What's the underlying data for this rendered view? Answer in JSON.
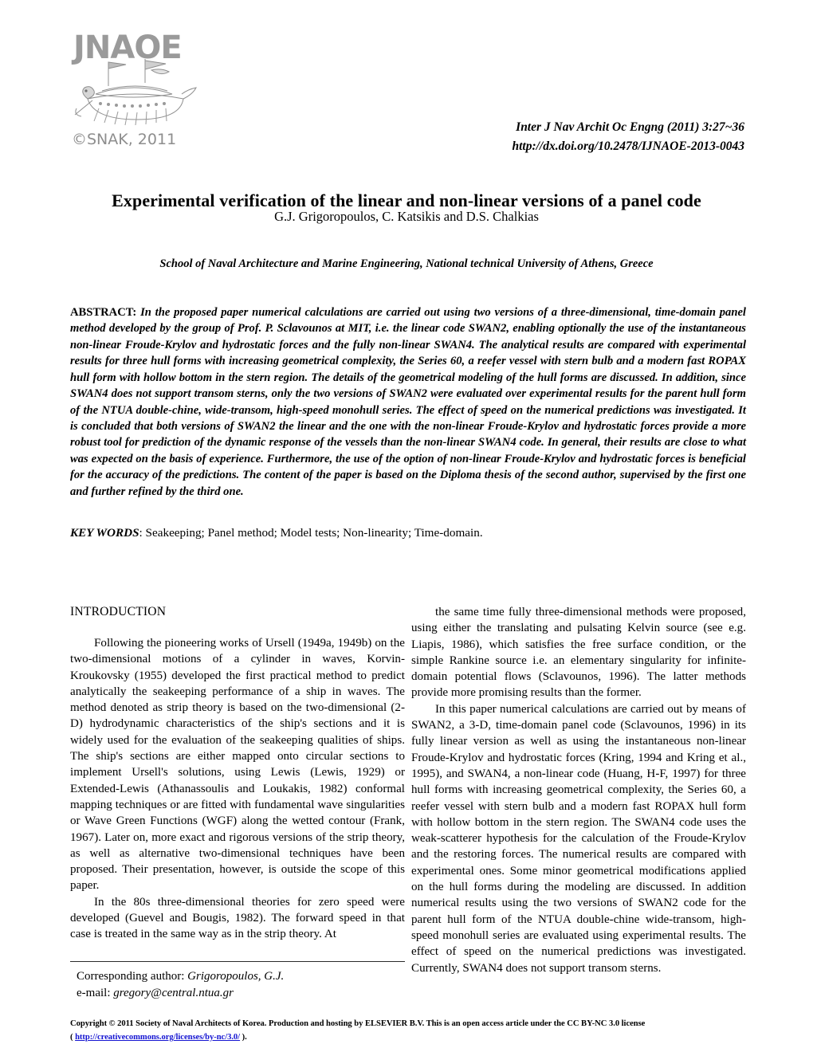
{
  "logo": {
    "wordmark": "JNAOE",
    "copyright_line": "©SNAK, 2011",
    "ship_icon": "turtle-ship-icon"
  },
  "journal": {
    "citation": "Inter J Nav Archit Oc Engng (2011) 3:27~36",
    "doi_url": "http://dx.doi.org/10.2478/IJNAOE-2013-0043"
  },
  "article": {
    "title": "Experimental verification of the linear and non-linear versions of a panel code",
    "authors": "G.J. Grigoropoulos, C. Katsikis and D.S. Chalkias",
    "affiliation": "School of Naval Architecture and Marine Engineering, National technical University of Athens, Greece"
  },
  "abstract": {
    "label": "ABSTRACT:",
    "text": " In the proposed paper numerical calculations are carried out using two versions of a three-dimensional, time-domain panel method developed by the group of Prof. P. Sclavounos at MIT, i.e. the linear code SWAN2, enabling optionally the use of the instantaneous non-linear Froude-Krylov and hydrostatic forces and the fully non-linear SWAN4. The analytical results are compared with experimental results for three hull forms with increasing geometrical complexity, the Series 60, a reefer vessel with stern bulb and a modern fast ROPAX hull form with hollow bottom in the stern region. The details of the geometrical modeling of the hull forms are discussed. In addition, since SWAN4 does not support transom sterns, only the two versions of SWAN2 were evaluated over experimental results for the parent hull form of the NTUA double-chine, wide-transom, high-speed monohull series. The effect of speed on the numerical predictions was investigated. It is concluded that both versions of SWAN2 the linear and the one with the non-linear Froude-Krylov and hydrostatic forces provide a more robust tool for prediction of the dynamic response of the vessels than the non-linear SWAN4 code. In general, their results are close to what was expected on the basis of experience. Furthermore, the use of the option of non-linear Froude-Krylov and hydrostatic forces is beneficial for the accuracy of the predictions. The content of the paper is based on the Diploma thesis of the second author, supervised by the first one and further refined by the third one."
  },
  "keywords": {
    "label": "KEY WORDS",
    "separator": ": ",
    "list": "Seakeeping; Panel method; Model tests; Non-linearity; Time-domain."
  },
  "body": {
    "section_heading": "INTRODUCTION",
    "left_paragraphs": [
      "Following the pioneering works of Ursell (1949a, 1949b) on the two-dimensional motions of a cylinder in waves, Korvin-Kroukovsky (1955) developed the first practical method to predict analytically the seakeeping performance of a ship in waves. The method denoted as strip theory is based on the two-dimensional (2-D) hydrodynamic characteristics of the ship's sections and it is widely used for the evaluation of the seakeeping qualities of ships. The ship's sections are either mapped onto circular sections to implement Ursell's solutions, using Lewis (Lewis, 1929) or Extended-Lewis (Athanassoulis and Loukakis, 1982) conformal mapping techniques or are fitted with fundamental wave singularities or Wave Green Functions (WGF) along the wetted contour (Frank, 1967). Later on, more exact and rigorous versions of the strip theory, as well as alternative two-dimensional techniques have been proposed. Their presentation, however, is outside the scope of this paper.",
      "In the 80s three-dimensional theories for zero speed were developed (Guevel and Bougis, 1982). The forward speed in that case is treated in the same way as in the strip theory. At"
    ],
    "right_paragraphs": [
      "the same time fully three-dimensional methods were proposed, using either the translating and pulsating Kelvin source (see e.g. Liapis, 1986), which satisfies the free surface condition, or the simple Rankine source i.e. an elementary singularity for infinite-domain potential flows (Sclavounos, 1996). The latter methods provide more promising results than the former.",
      "In this paper numerical calculations are carried out by means of SWAN2, a 3-D, time-domain panel code (Sclavounos, 1996) in its fully linear version as well as using the instantaneous non-linear Froude-Krylov and hydrostatic forces (Kring, 1994 and Kring et al., 1995), and SWAN4, a non-linear code (Huang, H-F, 1997) for three hull forms with increasing geometrical complexity, the Series 60, a reefer vessel with stern bulb and a modern fast ROPAX hull form with hollow bottom in the stern region. The SWAN4 code uses the weak-scatterer hypothesis for the calculation of the Froude-Krylov and the restoring forces. The numerical results are compared with experimental ones. Some minor geometrical modifications applied on the hull forms during the modeling are discussed. In addition numerical results using the two versions of SWAN2 code for the parent hull form of the NTUA double-chine wide-transom, high-speed monohull series are evaluated using experimental results. The effect of speed on the numerical predictions was investigated. Currently, SWAN4 does not support transom sterns."
    ]
  },
  "footnote": {
    "corresponding_label": "Corresponding author: ",
    "corresponding_name": "Grigoropoulos, G.J.",
    "email_label": "e-mail: ",
    "email_value": "gregory@central.ntua.gr"
  },
  "copyright": {
    "line1": "Copyright © 2011 Society of Naval Architects of Korea. Production and  hosting by ELSEVIER B.V. This is an open access article under the CC BY-NC 3.0 license",
    "open_paren": "( ",
    "license_url": "http://creativecommons.org/licenses/by-nc/3.0/",
    "close_paren": " )."
  },
  "colors": {
    "logo_gray": "#9a9a9a",
    "link_blue": "#1414d2",
    "text_black": "#000000"
  }
}
